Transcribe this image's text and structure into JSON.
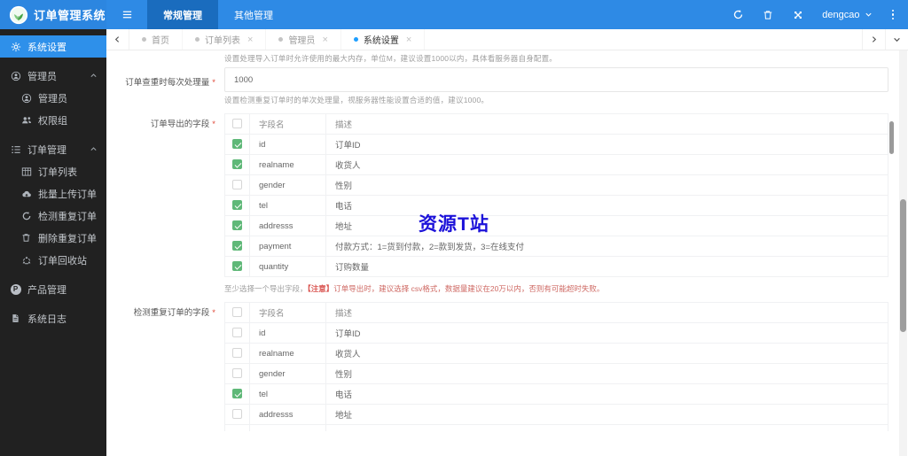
{
  "header": {
    "title": "订单管理系统",
    "menu": [
      {
        "label": "常规管理"
      },
      {
        "label": "其他管理"
      }
    ],
    "username": "dengcao"
  },
  "sidebar": {
    "items": [
      {
        "label": "系统设置"
      },
      {
        "label": "管理员"
      },
      {
        "label": "管理员"
      },
      {
        "label": "权限组"
      },
      {
        "label": "订单管理"
      },
      {
        "label": "订单列表"
      },
      {
        "label": "批量上传订单"
      },
      {
        "label": "检测重复订单"
      },
      {
        "label": "删除重复订单"
      },
      {
        "label": "订单回收站"
      },
      {
        "label": "产品管理",
        "icon_letter": "P"
      },
      {
        "label": "系统日志"
      }
    ]
  },
  "tabs": {
    "items": [
      {
        "label": "首页",
        "closable": false,
        "active": false
      },
      {
        "label": "订单列表",
        "closable": true,
        "active": false
      },
      {
        "label": "管理员",
        "closable": true,
        "active": false
      },
      {
        "label": "系统设置",
        "closable": true,
        "active": true
      }
    ],
    "close_glyph": "×"
  },
  "form": {
    "intro_help": "设置处理导入订单时允许使用的最大内存，单位M，建议设置1000以内，具体看服务器自身配置。",
    "required_mark": "*",
    "batch": {
      "label": "订单查重时每次处理量",
      "value": "1000",
      "help": "设置检测重复订单时的单次处理量，视服务器性能设置合适的值，建议1000。"
    },
    "export": {
      "label": "订单导出的字段",
      "note_prefix": "至少选择一个导出字段，",
      "note_em": "【注意】",
      "note_rest": "订单导出时，建议选择 csv格式，数据量建议在20万以内，否则有可能超时失败。"
    },
    "duplicate": {
      "label": "检测重复订单的字段"
    }
  },
  "export_table": {
    "col_field": "字段名",
    "col_desc": "描述",
    "rows": [
      {
        "field": "id",
        "desc": "订单ID",
        "checked": true
      },
      {
        "field": "realname",
        "desc": "收货人",
        "checked": true
      },
      {
        "field": "gender",
        "desc": "性别",
        "checked": false
      },
      {
        "field": "tel",
        "desc": "电话",
        "checked": true
      },
      {
        "field": "addresss",
        "desc": "地址",
        "checked": true
      },
      {
        "field": "payment",
        "desc": "付款方式：1=货到付款，2=款到发货，3=在线支付",
        "checked": true
      },
      {
        "field": "quantity",
        "desc": "订购数量",
        "checked": true
      }
    ]
  },
  "dup_table": {
    "col_field": "字段名",
    "col_desc": "描述",
    "rows": [
      {
        "field": "id",
        "desc": "订单ID",
        "checked": false
      },
      {
        "field": "realname",
        "desc": "收货人",
        "checked": false
      },
      {
        "field": "gender",
        "desc": "性别",
        "checked": false
      },
      {
        "field": "tel",
        "desc": "电话",
        "checked": true
      },
      {
        "field": "addresss",
        "desc": "地址",
        "checked": false
      }
    ]
  },
  "watermark": "资源T站",
  "colors": {
    "header_blue": "#2e8ae5",
    "header_active_blue": "#1a6cbe",
    "sidebar_bg": "#212121",
    "sidebar_active_blue": "#2e90ea",
    "accent_blue": "#1E9FFF",
    "check_green": "#5FB878",
    "note_red": "#d9534f",
    "watermark_blue": "#1c12d9"
  }
}
